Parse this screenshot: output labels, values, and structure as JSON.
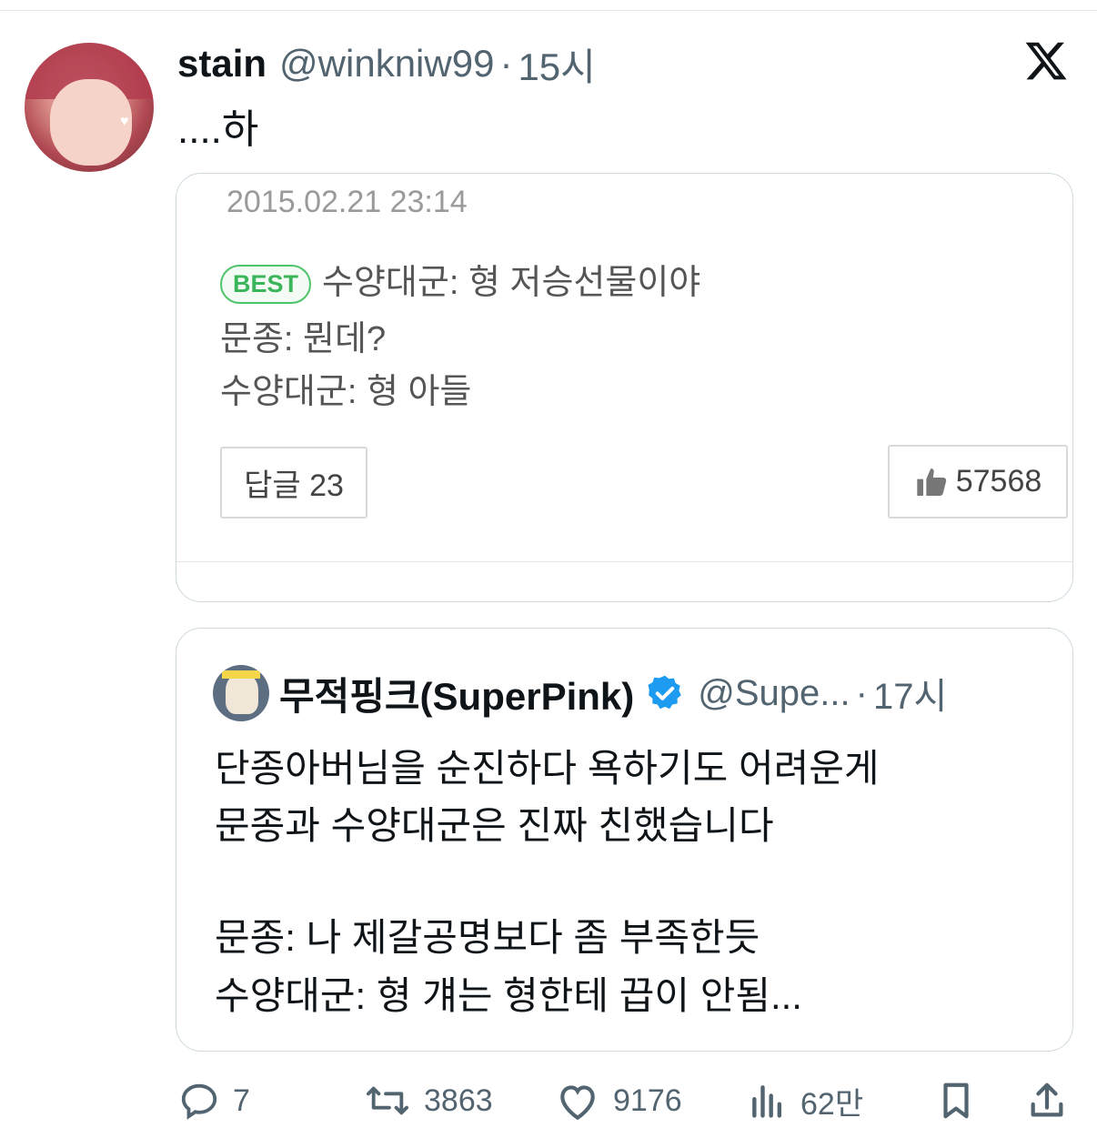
{
  "tweet": {
    "author_name": "stain",
    "handle": "@winkniw99",
    "separator": "·",
    "time": "15시",
    "text": "....하"
  },
  "embedded_image": {
    "date": "2015.02.21 23:14",
    "best_badge": "BEST",
    "lines": [
      "수양대군: 형 저승선물이야",
      "문종: 뭔데?",
      "수양대군: 형 아들"
    ],
    "reply_label": "답글 23",
    "like_count": "57568"
  },
  "quoted_tweet": {
    "author_name": "무적핑크(SuperPink)",
    "handle": "@Supe...",
    "separator": "·",
    "time": "17시",
    "lines": [
      "단종아버님을 순진하다 욕하기도 어려운게",
      "문종과 수양대군은 진짜 친했습니다",
      "문종: 나 제갈공명보다 좀 부족한듯",
      "수양대군: 형 걔는 형한테 끕이 안됨..."
    ]
  },
  "actions": {
    "replies": "7",
    "retweets": "3863",
    "likes": "9176",
    "views": "62만"
  },
  "icons": {
    "logo": "x-logo-icon",
    "verified": "verified-badge-icon",
    "reply": "reply-icon",
    "retweet": "retweet-icon",
    "like": "heart-icon",
    "views": "views-icon",
    "bookmark": "bookmark-icon",
    "share": "share-icon",
    "thumb": "thumbs-up-icon"
  },
  "colors": {
    "text": "#0f1419",
    "muted": "#536471",
    "verified": "#1d9bf0",
    "best": "#3bb55a"
  }
}
